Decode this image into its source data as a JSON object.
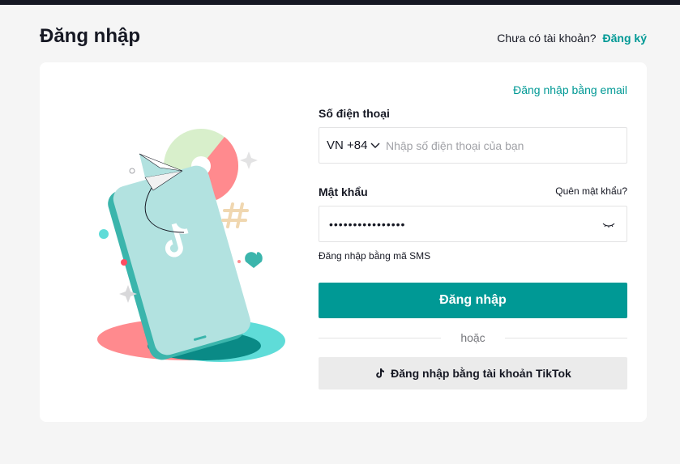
{
  "header": {
    "title": "Đăng nhập",
    "no_account_text": "Chưa có tài khoản?",
    "signup_link": "Đăng ký"
  },
  "form": {
    "email_login_link": "Đăng nhập bằng email",
    "phone_label": "Số điện thoại",
    "country_code": "VN +84",
    "phone_placeholder": "Nhập số điện thoại của bạn",
    "phone_value": "",
    "password_label": "Mật khẩu",
    "forgot_password": "Quên mật khẩu?",
    "password_value": "••••••••••••••••",
    "sms_login_link": "Đăng nhập bằng mã SMS",
    "login_button": "Đăng nhập",
    "or_text": "hoặc",
    "tiktok_button": "Đăng nhập bằng tài khoản TikTok"
  },
  "colors": {
    "accent": "#009995",
    "text": "#161823",
    "background": "#f5f5f5",
    "card": "#ffffff"
  },
  "icons": [
    "chevron-down-icon",
    "eye-closed-icon",
    "tiktok-icon",
    "phone-illustration"
  ]
}
